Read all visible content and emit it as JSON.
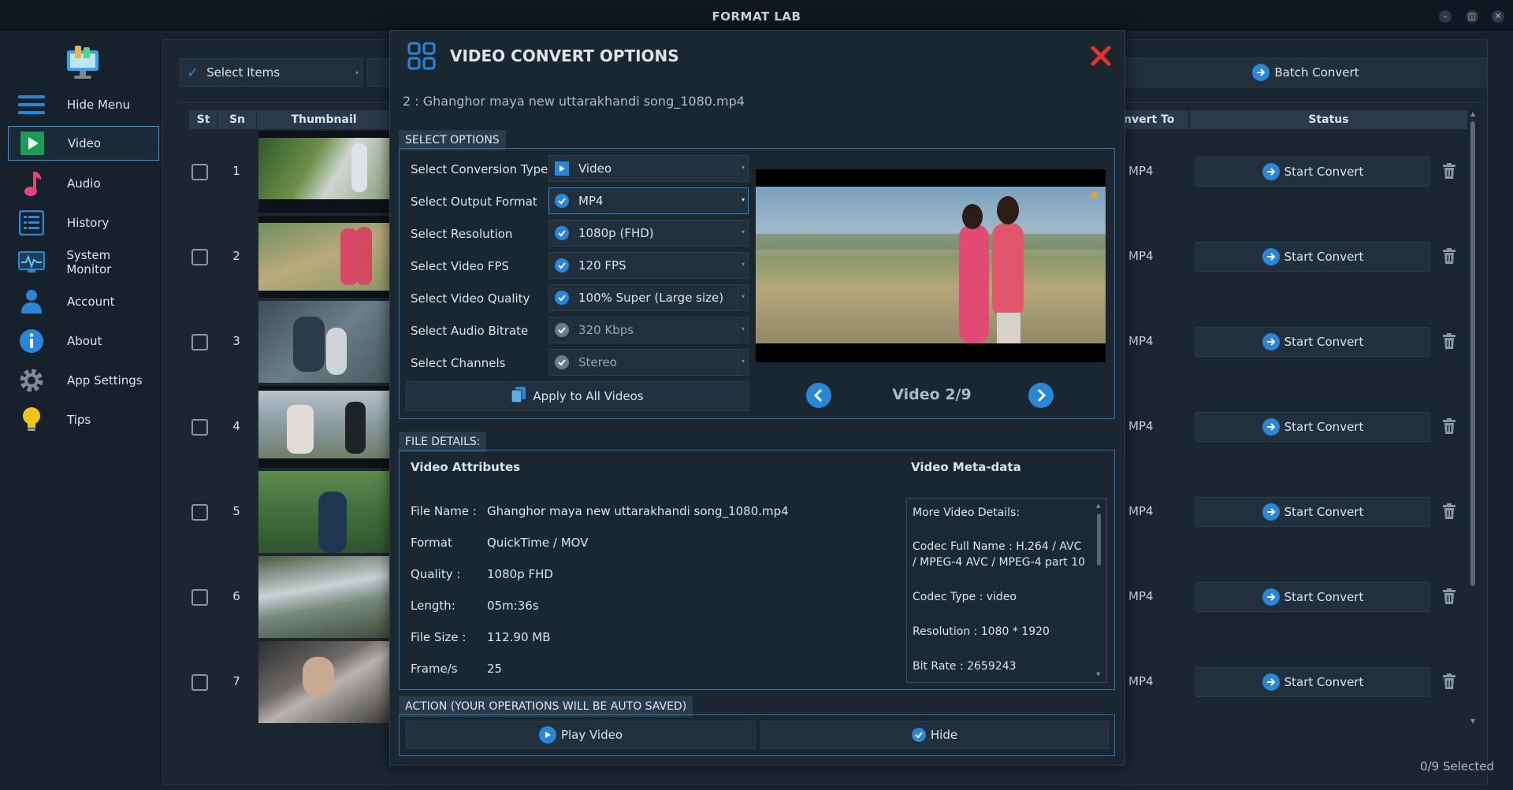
{
  "app": {
    "title": "FORMAT LAB"
  },
  "sidebar": {
    "items": [
      {
        "label": "Hide Menu"
      },
      {
        "label": "Video"
      },
      {
        "label": "Audio"
      },
      {
        "label": "History"
      },
      {
        "label": "System Monitor"
      },
      {
        "label": "Account"
      },
      {
        "label": "About"
      },
      {
        "label": "App Settings"
      },
      {
        "label": "Tips"
      }
    ]
  },
  "toolbar": {
    "select_items": "Select Items",
    "batch_convert": "Batch Convert"
  },
  "table": {
    "headers": {
      "st": "St",
      "sn": "Sn",
      "thumbnail": "Thumbnail",
      "convert_to": "nvert To",
      "status": "Status"
    },
    "rows": [
      {
        "sn": "1",
        "format": "MP4",
        "action": "Start Convert"
      },
      {
        "sn": "2",
        "format": "MP4",
        "action": "Start Convert"
      },
      {
        "sn": "3",
        "format": "MP4",
        "action": "Start Convert"
      },
      {
        "sn": "4",
        "format": "MP4",
        "action": "Start Convert"
      },
      {
        "sn": "5",
        "format": "MP4",
        "action": "Start Convert"
      },
      {
        "sn": "6",
        "format": "MP4",
        "action": "Start Convert"
      },
      {
        "sn": "7",
        "format": "MP4",
        "action": "Start Convert"
      }
    ],
    "selected_count": "0/9 Selected"
  },
  "modal": {
    "title": "VIDEO CONVERT OPTIONS",
    "file_label": "2 : Ghanghor maya new uttarakhandi song_1080.mp4",
    "select_options_tab": "SELECT OPTIONS",
    "options": [
      {
        "label": "Select Conversion Type",
        "value": "Video"
      },
      {
        "label": "Select Output Format",
        "value": "MP4"
      },
      {
        "label": "Select Resolution",
        "value": "1080p (FHD)"
      },
      {
        "label": "Select Video FPS",
        "value": "120 FPS"
      },
      {
        "label": "Select Video Quality",
        "value": "100% Super (Large size)"
      },
      {
        "label": "Select Audio Bitrate",
        "value": "320 Kbps"
      },
      {
        "label": "Select Channels",
        "value": "Stereo"
      }
    ],
    "apply_all": "Apply to All Videos",
    "video_counter": "Video 2/9",
    "file_details_tab": "FILE DETAILS:",
    "video_attributes_heading": "Video Attributes",
    "video_metadata_heading": "Video Meta-data",
    "attributes": [
      {
        "label": "File Name :",
        "value": "Ghanghor maya new uttarakhandi song_1080.mp4"
      },
      {
        "label": "Format",
        "value": "QuickTime / MOV"
      },
      {
        "label": "Quality :",
        "value": "1080p FHD"
      },
      {
        "label": "Length:",
        "value": "05m:36s"
      },
      {
        "label": "File Size :",
        "value": "112.90 MB"
      },
      {
        "label": "Frame/s",
        "value": "25"
      }
    ],
    "metadata": {
      "heading": "More Video Details:",
      "codec_full": "Codec Full Name : H.264 / AVC / MPEG-4 AVC / MPEG-4 part 10",
      "codec_type": "Codec Type : video",
      "resolution": "Resolution : 1080 * 1920",
      "bit_rate": "Bit Rate : 2659243"
    },
    "action_tab": "ACTION (YOUR OPERATIONS WILL BE AUTO SAVED)",
    "play_video": "Play Video",
    "hide": "Hide"
  },
  "colors": {
    "accent": "#2a86d6",
    "close": "#e8322c",
    "background": "#17212c"
  }
}
